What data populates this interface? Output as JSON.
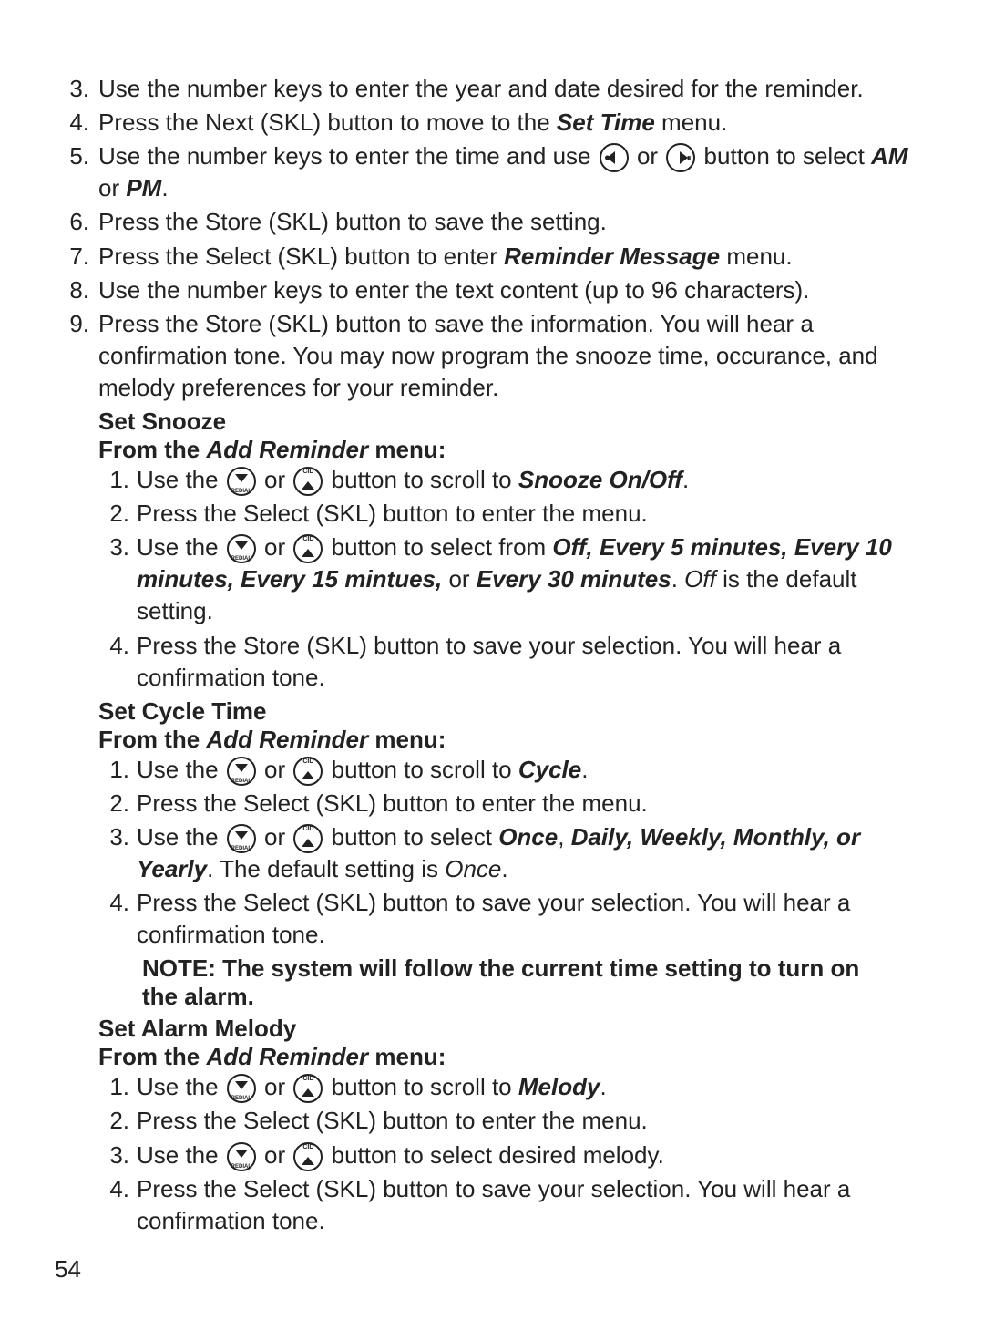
{
  "main_list": {
    "item3": {
      "num": "3.",
      "text": "Use the number keys to enter the year and date desired for the reminder."
    },
    "item4": {
      "num": "4.",
      "pre": "Press the Next (SKL) button to move to the ",
      "bi": "Set Time",
      "post": " menu."
    },
    "item5": {
      "num": "5.",
      "pre": "Use the number keys to enter the time and use ",
      "mid": " or ",
      "post1": " button to select ",
      "bi1": "AM",
      "post2": " or ",
      "bi2": "PM",
      "end": "."
    },
    "item6": {
      "num": "6.",
      "text": "Press the Store (SKL) button to save the setting."
    },
    "item7": {
      "num": "7.",
      "pre": "Press the Select (SKL) button to enter ",
      "bi": "Reminder Message",
      "post": " menu."
    },
    "item8": {
      "num": "8.",
      "text": "Use the number keys to enter the text content (up to 96 characters)."
    },
    "item9": {
      "num": "9.",
      "text": "Press the Store (SKL) button to save the information. You will hear a confirmation tone. You may now program the snooze time, occurance, and melody preferences for your reminder."
    }
  },
  "snooze": {
    "title": "Set Snooze",
    "subtitle_pre": "From the ",
    "subtitle_bi": "Add Reminder",
    "subtitle_post": " menu:",
    "item1": {
      "num": "1.",
      "pre": "Use the ",
      "or": " or ",
      "mid": " button to scroll to ",
      "bi": "Snooze On/Off",
      "end": "."
    },
    "item2": {
      "num": "2.",
      "text": "Press the Select (SKL) button to enter the menu."
    },
    "item3": {
      "num": "3.",
      "pre": "Use the ",
      "or": " or ",
      "mid": " button to select from ",
      "bi": "Off, Every 5 minutes, Every 10 minutes, Every 15 mintues,",
      "post1": " or ",
      "bi2": "Every 30 minutes",
      "post2": ". ",
      "i": "Off",
      "post3": " is the default setting."
    },
    "item4": {
      "num": "4.",
      "text": "Press the Store (SKL) button to save your selection. You will hear a confirmation tone."
    }
  },
  "cycle": {
    "title": "Set Cycle Time",
    "subtitle_pre": "From the ",
    "subtitle_bi": "Add Reminder",
    "subtitle_post": " menu:",
    "item1": {
      "num": "1.",
      "pre": "Use the ",
      "or": " or ",
      "mid": " button to scroll to ",
      "bi": "Cycle",
      "end": "."
    },
    "item2": {
      "num": "2.",
      "text": "Press the Select (SKL) button to enter the menu."
    },
    "item3": {
      "num": "3.",
      "pre": "Use the ",
      "or": " or ",
      "mid": " button to select ",
      "bi1": "Once",
      "comma": ", ",
      "bi2": "Daily, Weekly, Monthly, or Yearly",
      "post": ". The default setting is ",
      "i": "Once",
      "end": "."
    },
    "item4": {
      "num": "4.",
      "text": "Press the Select (SKL) button to save your selection. You will hear a confirmation tone."
    },
    "note": "NOTE: The system will follow the current time setting to turn on the alarm."
  },
  "melody": {
    "title": "Set Alarm Melody",
    "subtitle_pre": "From the ",
    "subtitle_bi": "Add Reminder",
    "subtitle_post": " menu:",
    "item1": {
      "num": "1.",
      "pre": "Use the ",
      "or": " or ",
      "mid": " button to scroll to ",
      "bi": "Melody",
      "end": "."
    },
    "item2": {
      "num": "2.",
      "text": "Press the Select (SKL) button to enter the menu."
    },
    "item3": {
      "num": "3.",
      "pre": "Use the ",
      "or": " or ",
      "post": " button to select desired melody."
    },
    "item4": {
      "num": "4.",
      "text": "Press the Select (SKL) button to save your selection. You will hear a confirmation tone."
    }
  },
  "page_number": "54",
  "icons": {
    "down_top": "",
    "down_bot": "REDIAL",
    "up_top": "CID",
    "up_bot": "",
    "left_sym": "",
    "right_sym": ""
  }
}
